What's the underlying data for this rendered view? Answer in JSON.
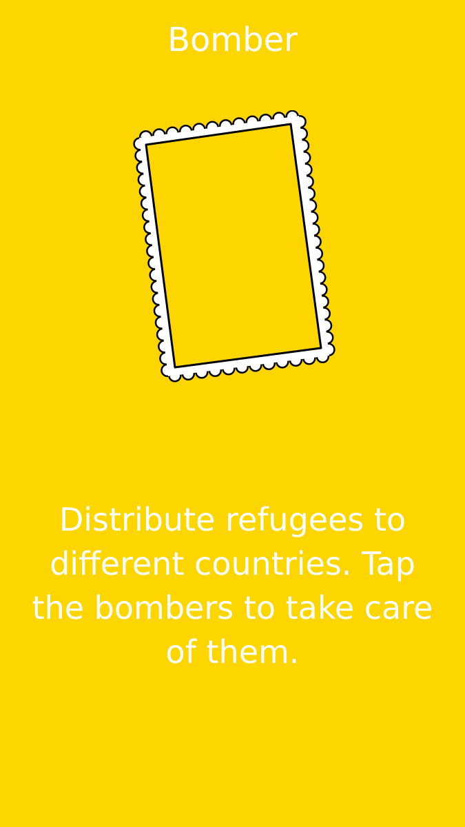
{
  "screen": {
    "background_color": "#FDD600",
    "text_color": "#FFFFFF"
  },
  "header": {
    "title": "Bomber"
  },
  "card": {
    "type": "stamp-frame",
    "fill_color": "#FDD600",
    "outline_color": "#000000"
  },
  "instructions": {
    "text": "Distribute refugees to different countries. Tap the bombers to take care of them."
  }
}
